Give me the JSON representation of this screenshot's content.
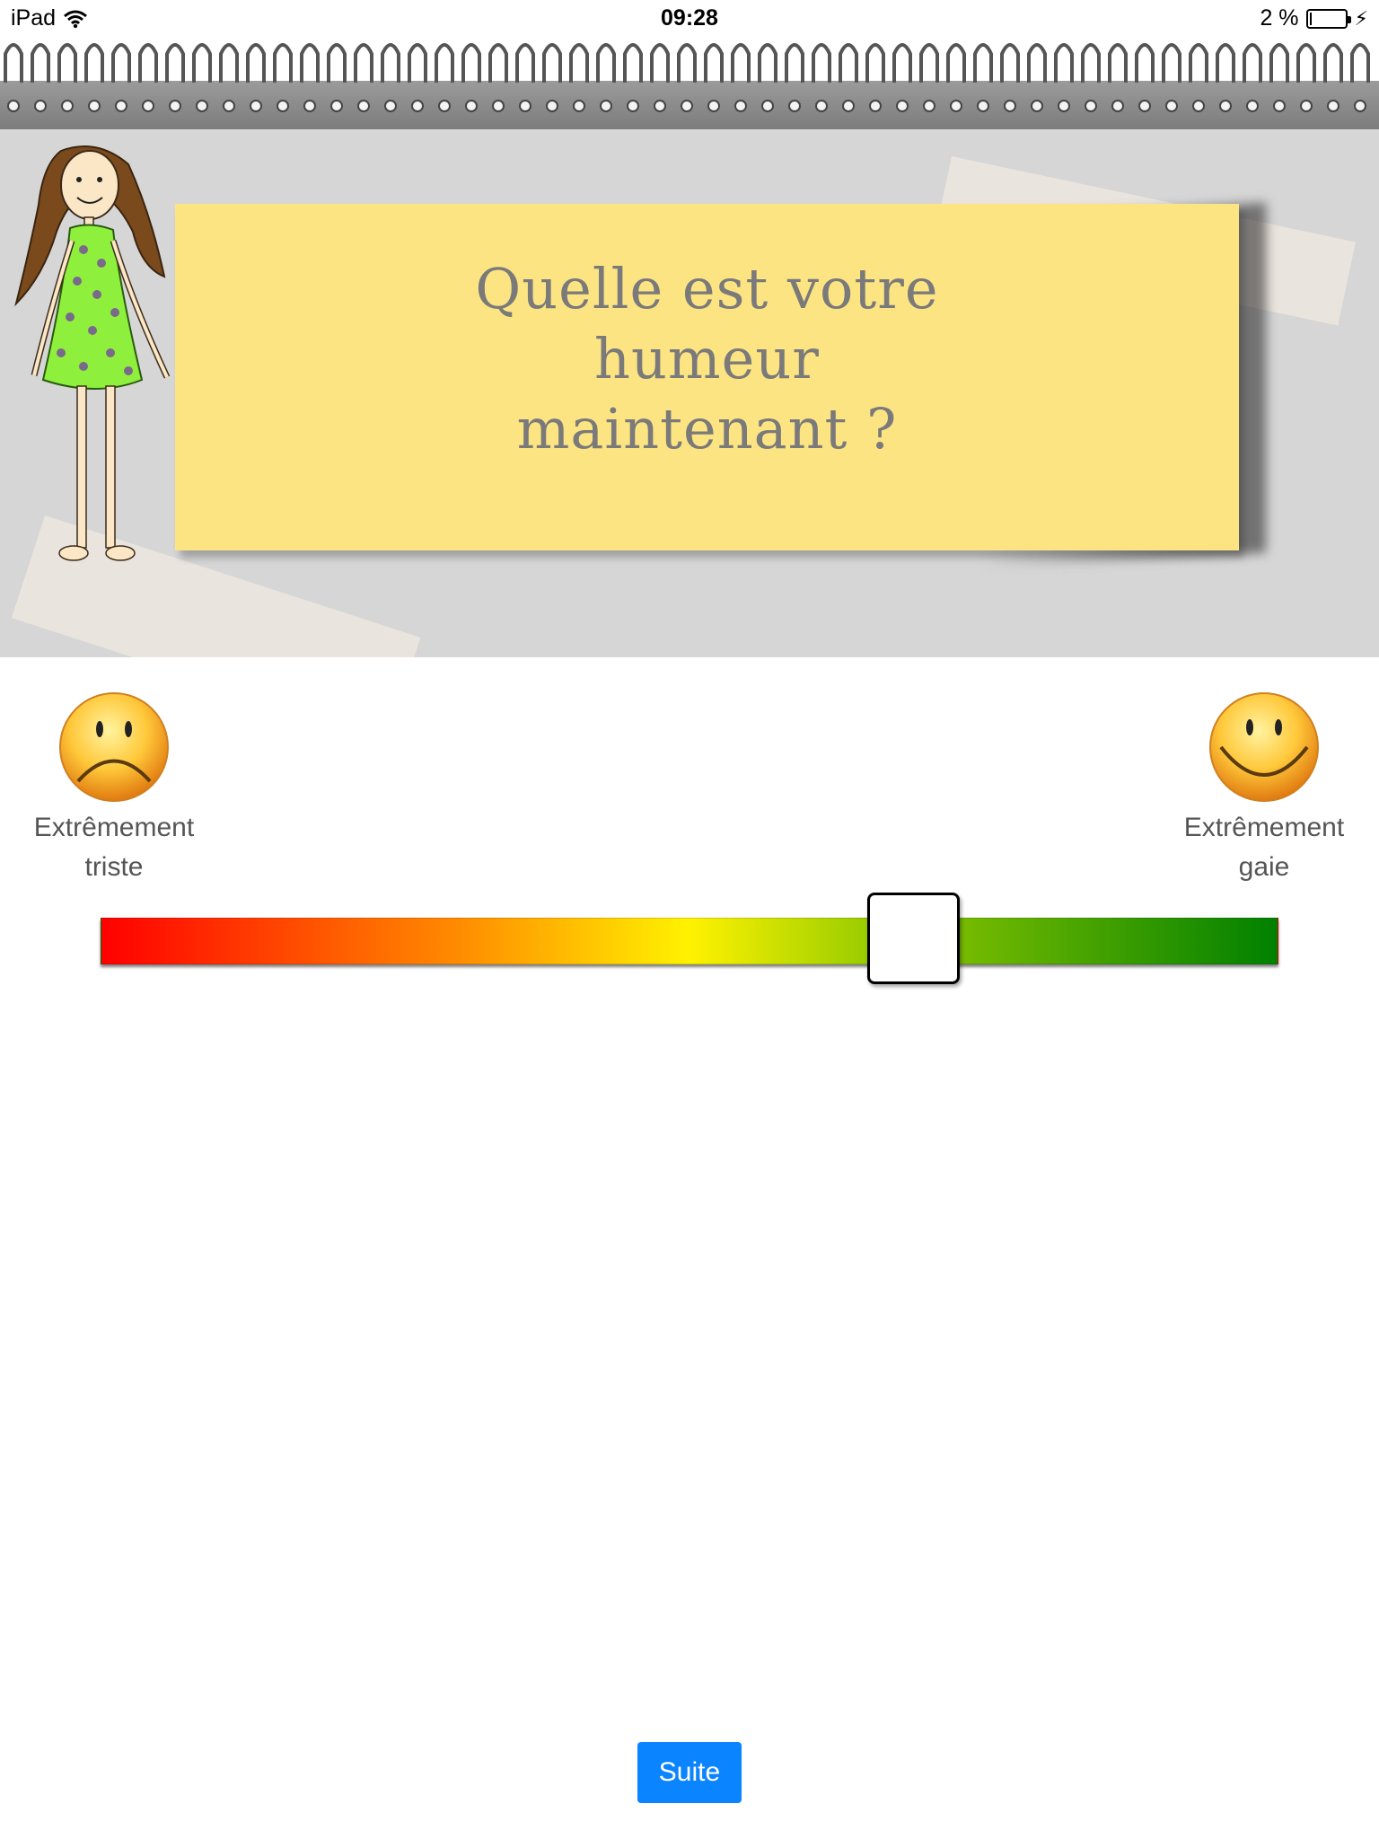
{
  "status_bar": {
    "device": "iPad",
    "time": "09:28",
    "battery_percent": "2 %"
  },
  "question": {
    "text": "Quelle est votre humeur maintenant ?"
  },
  "mood_scale": {
    "left_label": "Extrêmement triste",
    "right_label": "Extrêmement gaie",
    "slider_value": 0.69,
    "gradient_colors": [
      "#ff0000",
      "#ff8a00",
      "#fff200",
      "#9acd00",
      "#008000"
    ]
  },
  "actions": {
    "next_label": "Suite",
    "next_color": "#0a84ff"
  },
  "colors": {
    "sticky_note": "#fde483",
    "header_background": "#d6d6d6",
    "question_text": "#7a7a7a"
  },
  "icons": {
    "sad": "sad-face-icon",
    "happy": "happy-face-icon",
    "wifi": "wifi-icon",
    "battery": "battery-icon"
  }
}
